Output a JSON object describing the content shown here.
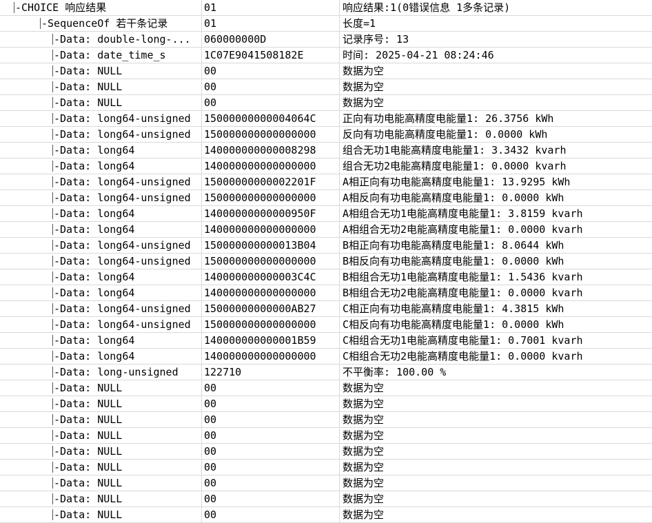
{
  "rows": [
    {
      "depth": 0,
      "name": "-CHOICE 响应结果",
      "value": "01",
      "desc": "响应结果:1(0错误信息 1多条记录)"
    },
    {
      "depth": 1,
      "name": "-SequenceOf 若干条记录",
      "value": "01",
      "desc": "长度=1"
    },
    {
      "depth": 2,
      "name": "-Data: double-long-...",
      "value": "060000000D",
      "desc": "记录序号: 13"
    },
    {
      "depth": 2,
      "name": "-Data: date_time_s",
      "value": "1C07E9041508182E",
      "desc": "时间: 2025-04-21 08:24:46"
    },
    {
      "depth": 2,
      "name": "-Data: NULL",
      "value": "00",
      "desc": "数据为空"
    },
    {
      "depth": 2,
      "name": "-Data: NULL",
      "value": "00",
      "desc": "数据为空"
    },
    {
      "depth": 2,
      "name": "-Data: NULL",
      "value": "00",
      "desc": "数据为空"
    },
    {
      "depth": 2,
      "name": "-Data: long64-unsigned",
      "value": "15000000000004064C",
      "desc": "正向有功电能高精度电能量1: 26.3756 kWh"
    },
    {
      "depth": 2,
      "name": "-Data: long64-unsigned",
      "value": "150000000000000000",
      "desc": "反向有功电能高精度电能量1: 0.0000 kWh"
    },
    {
      "depth": 2,
      "name": "-Data: long64",
      "value": "140000000000008298",
      "desc": "组合无功1电能高精度电能量1: 3.3432 kvarh"
    },
    {
      "depth": 2,
      "name": "-Data: long64",
      "value": "140000000000000000",
      "desc": "组合无功2电能高精度电能量1: 0.0000 kvarh"
    },
    {
      "depth": 2,
      "name": "-Data: long64-unsigned",
      "value": "15000000000002201F",
      "desc": "A相正向有功电能高精度电能量1: 13.9295 kWh"
    },
    {
      "depth": 2,
      "name": "-Data: long64-unsigned",
      "value": "150000000000000000",
      "desc": "A相反向有功电能高精度电能量1: 0.0000 kWh"
    },
    {
      "depth": 2,
      "name": "-Data: long64",
      "value": "14000000000000950F",
      "desc": "A相组合无功1电能高精度电能量1: 3.8159 kvarh"
    },
    {
      "depth": 2,
      "name": "-Data: long64",
      "value": "140000000000000000",
      "desc": "A相组合无功2电能高精度电能量1: 0.0000 kvarh"
    },
    {
      "depth": 2,
      "name": "-Data: long64-unsigned",
      "value": "150000000000013B04",
      "desc": "B相正向有功电能高精度电能量1: 8.0644 kWh"
    },
    {
      "depth": 2,
      "name": "-Data: long64-unsigned",
      "value": "150000000000000000",
      "desc": "B相反向有功电能高精度电能量1: 0.0000 kWh"
    },
    {
      "depth": 2,
      "name": "-Data: long64",
      "value": "140000000000003C4C",
      "desc": "B相组合无功1电能高精度电能量1: 1.5436 kvarh"
    },
    {
      "depth": 2,
      "name": "-Data: long64",
      "value": "140000000000000000",
      "desc": "B相组合无功2电能高精度电能量1: 0.0000 kvarh"
    },
    {
      "depth": 2,
      "name": "-Data: long64-unsigned",
      "value": "15000000000000AB27",
      "desc": "C相正向有功电能高精度电能量1: 4.3815 kWh"
    },
    {
      "depth": 2,
      "name": "-Data: long64-unsigned",
      "value": "150000000000000000",
      "desc": "C相反向有功电能高精度电能量1: 0.0000 kWh"
    },
    {
      "depth": 2,
      "name": "-Data: long64",
      "value": "140000000000001B59",
      "desc": "C相组合无功1电能高精度电能量1: 0.7001 kvarh"
    },
    {
      "depth": 2,
      "name": "-Data: long64",
      "value": "140000000000000000",
      "desc": "C相组合无功2电能高精度电能量1: 0.0000 kvarh"
    },
    {
      "depth": 2,
      "name": "-Data: long-unsigned",
      "value": "122710",
      "desc": "不平衡率: 100.00 %"
    },
    {
      "depth": 2,
      "name": "-Data: NULL",
      "value": "00",
      "desc": "数据为空"
    },
    {
      "depth": 2,
      "name": "-Data: NULL",
      "value": "00",
      "desc": "数据为空"
    },
    {
      "depth": 2,
      "name": "-Data: NULL",
      "value": "00",
      "desc": "数据为空"
    },
    {
      "depth": 2,
      "name": "-Data: NULL",
      "value": "00",
      "desc": "数据为空"
    },
    {
      "depth": 2,
      "name": "-Data: NULL",
      "value": "00",
      "desc": "数据为空"
    },
    {
      "depth": 2,
      "name": "-Data: NULL",
      "value": "00",
      "desc": "数据为空"
    },
    {
      "depth": 2,
      "name": "-Data: NULL",
      "value": "00",
      "desc": "数据为空"
    },
    {
      "depth": 2,
      "name": "-Data: NULL",
      "value": "00",
      "desc": "数据为空"
    },
    {
      "depth": 2,
      "name": "-Data: NULL",
      "value": "00",
      "desc": "数据为空"
    }
  ]
}
